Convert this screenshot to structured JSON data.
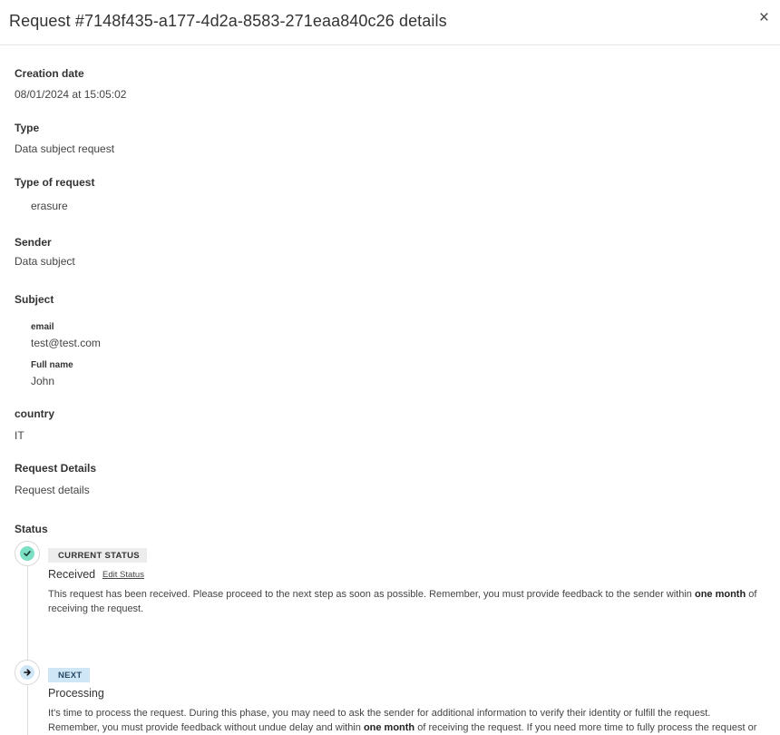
{
  "modal": {
    "title": "Request #7148f435-a177-4d2a-8583-271eaa840c26 details",
    "close": "×"
  },
  "fields": {
    "creation_date_label": "Creation date",
    "creation_date_value": "08/01/2024 at 15:05:02",
    "type_label": "Type",
    "type_value": "Data subject request",
    "type_of_request_label": "Type of request",
    "type_of_request_value": "erasure",
    "sender_label": "Sender",
    "sender_value": "Data subject",
    "subject_label": "Subject",
    "subject": {
      "email_label": "email",
      "email_value": "test@test.com",
      "fullname_label": "Full name",
      "fullname_value": "John"
    },
    "country_label": "country",
    "country_value": "IT",
    "request_details_label": "Request Details",
    "request_details_value": "Request details",
    "status_label": "Status"
  },
  "timeline": {
    "current": {
      "badge": "CURRENT STATUS",
      "title": "Received",
      "edit_label": "Edit Status",
      "text_before": "This request has been received. Please proceed to the next step as soon as possible. Remember, you must provide feedback to the sender within ",
      "text_bold": "one month",
      "text_after": " of receiving the request.",
      "icon": "check-icon",
      "icon_color": "#7be0c3"
    },
    "next": {
      "badge": "NEXT",
      "title": "Processing",
      "line1": "It's time to process the request. During this phase, you may need to ask the sender for additional information to verify their identity or fulfill the request.",
      "line2_before": "Remember, you must provide feedback without undue delay and within ",
      "line2_bold": "one month",
      "line2_after": " of receiving the request. If you need more time to fully process the request or",
      "icon": "arrow-right-icon",
      "icon_color": "#cfe6f7"
    }
  }
}
